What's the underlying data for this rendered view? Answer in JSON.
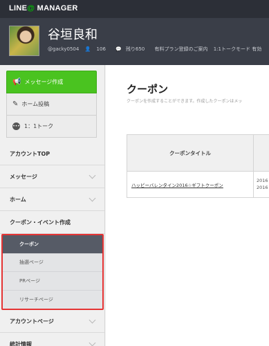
{
  "header": {
    "logo_main": "LINE",
    "logo_at": "@",
    "logo_sub": " MANAGER"
  },
  "profile": {
    "name": "谷垣良和",
    "account_id": "@gacky0504",
    "friends": "106",
    "remaining": "残り650",
    "plan_link": "有料プラン登録のご案内",
    "talk_mode": "1:1トークモード 有効"
  },
  "sidebar": {
    "buttons": [
      {
        "label": "メッセージ作成",
        "icon": "megaphone-icon"
      },
      {
        "label": "ホーム投稿",
        "icon": "pencil-icon"
      },
      {
        "label": "1：1トーク",
        "icon": "chat-icon"
      }
    ],
    "menu": [
      {
        "label": "アカウントTOP",
        "chevron": false
      },
      {
        "label": "メッセージ",
        "chevron": true
      },
      {
        "label": "ホーム",
        "chevron": true
      },
      {
        "label": "クーポン・イベント作成",
        "chevron": false
      }
    ],
    "submenu": [
      {
        "label": "クーポン",
        "active": true
      },
      {
        "label": "抽選ページ",
        "active": false
      },
      {
        "label": "PRページ",
        "active": false
      },
      {
        "label": "リサーチページ",
        "active": false
      }
    ],
    "bottom_menu": [
      {
        "label": "アカウントページ",
        "chevron": true
      },
      {
        "label": "統計情報",
        "chevron": true
      }
    ]
  },
  "main": {
    "title": "クーポン",
    "description": "クーポンを作成することができます。作成したクーポンはメッ",
    "table": {
      "header": "クーポンタイトル",
      "rows": [
        {
          "title": "ハッピーバレンタイン2016☆ギフトクーポン",
          "date_1": "2016",
          "date_2": "2016"
        }
      ]
    }
  },
  "colors": {
    "topbar": "#2c2f37",
    "primary_button": "#4ac320",
    "highlight_border": "#e53333",
    "active_submenu": "#565b66"
  }
}
